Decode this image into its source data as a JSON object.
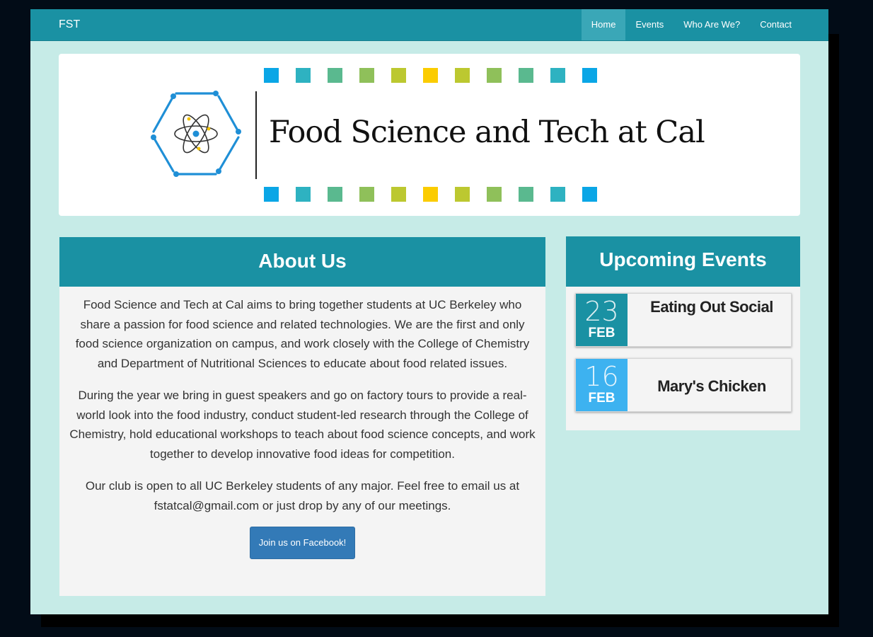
{
  "navbar": {
    "brand": "FST",
    "items": [
      {
        "label": "Home",
        "active": true
      },
      {
        "label": "Events"
      },
      {
        "label": "Who Are We?"
      },
      {
        "label": "Contact"
      }
    ]
  },
  "banner": {
    "logo_text": "Food Science and Tech at Cal",
    "square_colors": [
      "#0aa6e6",
      "#2eb2c1",
      "#5ab98f",
      "#8fc05a",
      "#bcc830",
      "#fbcc00",
      "#bcc830",
      "#8fc05a",
      "#5ab98f",
      "#2eb2c1",
      "#0aa6e6"
    ]
  },
  "about": {
    "title": "About Us",
    "paragraphs": [
      "Food Science and Tech at Cal aims to bring together students at UC Berkeley who share a passion for food science and related technologies. We are the first and only food science organization on campus, and work closely with the College of Chemistry and Department of Nutritional Sciences to educate about food related issues.",
      "During the year we bring in guest speakers and go on factory tours to provide a real-world look into the food industry, conduct student-led research through the College of Chemistry, hold educational workshops to teach about food science concepts, and work together to develop innovative food ideas for competition.",
      "Our club is open to all UC Berkeley students of any major. Feel free to email us at fstatcal@gmail.com or just drop by any of our meetings."
    ],
    "button_label": "Join us on Facebook!"
  },
  "events": {
    "title": "Upcoming Events",
    "items": [
      {
        "day": "23",
        "month": "FEB",
        "title": "Eating Out Social",
        "color": "#1a91a3"
      },
      {
        "day": "16",
        "month": "FEB",
        "title": "Mary's Chicken",
        "color": "#3db2f0"
      }
    ]
  },
  "colors": {
    "navbar": "#1a91a3",
    "page_background": "#c6ebe7",
    "button": "#337ab7"
  }
}
